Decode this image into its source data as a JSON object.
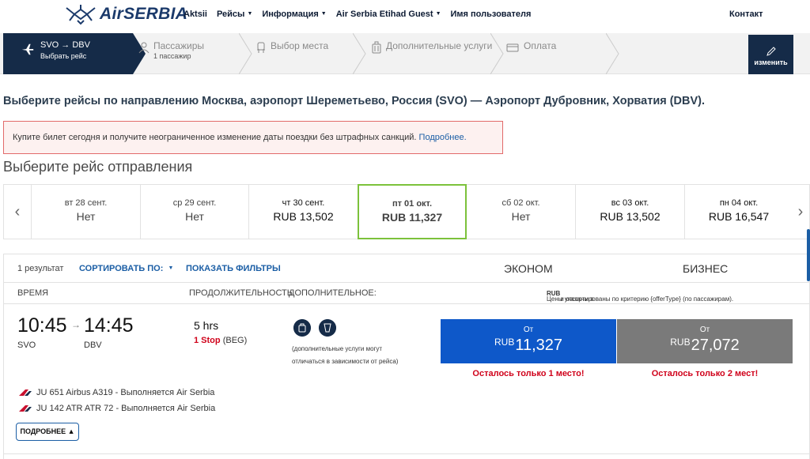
{
  "nav": {
    "logo_text": "AirSERBIA",
    "items": [
      {
        "label": "Aktsii",
        "caret": false
      },
      {
        "label": "Рейсы",
        "caret": true
      },
      {
        "label": "Информация",
        "caret": true
      },
      {
        "label": "Air Serbia Etihad Guest",
        "caret": true
      },
      {
        "label": "Имя пользователя",
        "caret": false
      }
    ],
    "contact": "Контакт"
  },
  "steps": {
    "active": {
      "route": "SVO → DBV",
      "sub": "Выбрать рейс",
      "icon": "plane-icon"
    },
    "passengers": {
      "label": "Пассажиры",
      "sub": "1 пассажир",
      "icon": "person-icon"
    },
    "seat": {
      "label": "Выбор места",
      "icon": "seat-icon"
    },
    "services": {
      "label": "Дополнительные услуги",
      "icon": "luggage-icon"
    },
    "payment": {
      "label": "Оплата",
      "icon": "card-icon"
    },
    "edit_label": "изменить"
  },
  "route_title": "Выберите рейсы по направлению Москва, аэропорт Шереметьево, Россия (SVO) — Аэропорт Дубровник, Хорватия (DBV).",
  "promo": {
    "text": "Купите билет сегодня и получите неограниченное изменение даты поездки без штрафных санкций. ",
    "link": "Подробнее."
  },
  "section_title": "Выберите рейс отправления",
  "dates": [
    {
      "day": "вт 28 сент.",
      "price": "Нет",
      "selected": false
    },
    {
      "day": "ср 29 сент.",
      "price": "Нет",
      "selected": false
    },
    {
      "day": "чт 30 сент.",
      "price": "RUB 13,502",
      "selected": false
    },
    {
      "day": "пт 01 окт.",
      "price": "RUB 11,327",
      "selected": true
    },
    {
      "day": "сб 02 окт.",
      "price": "Нет",
      "selected": false
    },
    {
      "day": "вс 03 окт.",
      "price": "RUB 13,502",
      "selected": false
    },
    {
      "day": "пн 04 окт.",
      "price": "RUB 16,547",
      "selected": false
    }
  ],
  "results": {
    "count": "1 результат",
    "sort_label": "СОРТИРОВАТЬ ПО:",
    "filters_label": "ПОКАЗАТЬ ФИЛЬТРЫ",
    "cabin_economy": "ЭКОНОМ",
    "cabin_business": "БИЗНЕС",
    "col_time": "ВРЕМЯ",
    "col_duration": "ПРОДОЛЖИТЕЛЬНОСТЬ",
    "col_extra": "ДОПОЛНИТЕЛЬНОЕ:",
    "price_note_pre": "Цены указаны в ",
    "price_note_cur": "RUB",
    "price_note_post": " и отсортированы по критерию {offerType} (по пассажирам)."
  },
  "flight": {
    "depart_time": "10:45",
    "arrive_time": "14:45",
    "depart_airport": "SVO",
    "arrive_airport": "DBV",
    "duration": "5 hrs",
    "stops": "1 Stop",
    "via": "(BEG)",
    "services_note": "(дополнительные услуги могут отличаться в зависимости от рейса)",
    "economy": {
      "from": "От",
      "currency": "RUB",
      "amount": "11,327",
      "seats_left": "Осталось только 1 место!"
    },
    "business": {
      "from": "От",
      "currency": "RUB",
      "amount": "27,072",
      "seats_left": "Осталось только 2 мест!"
    },
    "segments": [
      {
        "text": "JU 651  Airbus A319 - Выполняется Air Serbia"
      },
      {
        "text": "JU 142  ATR ATR 72 - Выполняется Air Serbia"
      }
    ],
    "details_label": "ПОДРОБНЕЕ"
  },
  "colors": {
    "navy": "#152b48",
    "economy": "#0e58c9",
    "business": "#7a7a7a",
    "selected_date": "#7cc23b",
    "alert": "#d0021b"
  }
}
